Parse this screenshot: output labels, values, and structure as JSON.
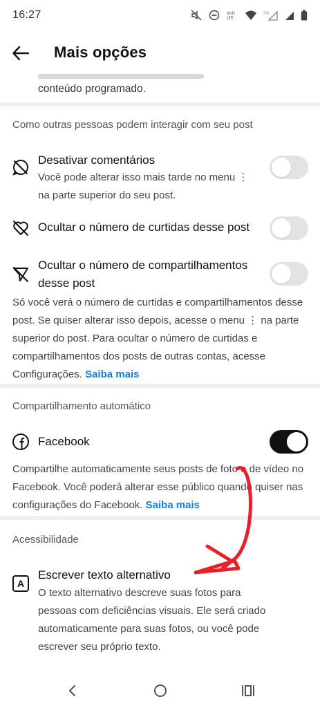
{
  "status_bar": {
    "time": "16:27",
    "icons": [
      "mute-icon",
      "dnd-icon",
      "volte-icon",
      "wifi-icon",
      "signal-icon",
      "signal-5g-icon",
      "battery-icon"
    ],
    "volte_label": "Vo))\nLTE",
    "network_label": "5G"
  },
  "header": {
    "title": "Mais opções",
    "back_icon": "arrow-left-icon"
  },
  "top_fragment": {
    "text": "conteúdo programado."
  },
  "interaction": {
    "section_title": "Como outras pessoas podem interagir com seu post",
    "disable_comments": {
      "title": "Desativar comentários",
      "subtitle": "Você pode alterar isso mais tarde no menu ⋮ na parte superior do seu post.",
      "enabled": false
    },
    "hide_likes": {
      "title": "Ocultar o número de curtidas desse post",
      "enabled": false
    },
    "hide_shares": {
      "title": "Ocultar o número de compartilhamentos desse post",
      "enabled": false
    },
    "info_text": "Só você verá o número de curtidas e compartilhamentos desse post. Se quiser alterar isso depois, acesse o menu ⋮ na parte superior do post. Para ocultar o número de curtidas e compartilhamentos dos posts de outras contas, acesse Configurações.",
    "info_link": "Saiba mais"
  },
  "auto_share": {
    "section_title": "Compartilhamento automático",
    "facebook": {
      "title": "Facebook",
      "enabled": true
    },
    "info_text": "Compartilhe automaticamente seus posts de foto e de vídeo no Facebook. Você poderá alterar esse público quando quiser nas configurações do Facebook.",
    "info_link": "Saiba mais"
  },
  "accessibility": {
    "section_title": "Acessibilidade",
    "alt_text": {
      "icon_letter": "A",
      "title": "Escrever texto alternativo",
      "description": "O texto alternativo descreve suas fotos para pessoas com deficiências visuais. Ele será criado automaticamente para suas fotos, ou você pode escrever seu próprio texto."
    }
  },
  "nav_bar": {
    "buttons": [
      "back-nav-icon",
      "home-nav-icon",
      "recents-nav-icon"
    ]
  },
  "colors": {
    "accent_link": "#1a7ad6",
    "toggle_on": "#111111",
    "toggle_off": "#e3e3e6",
    "annotation_arrow": "#e8202a"
  }
}
